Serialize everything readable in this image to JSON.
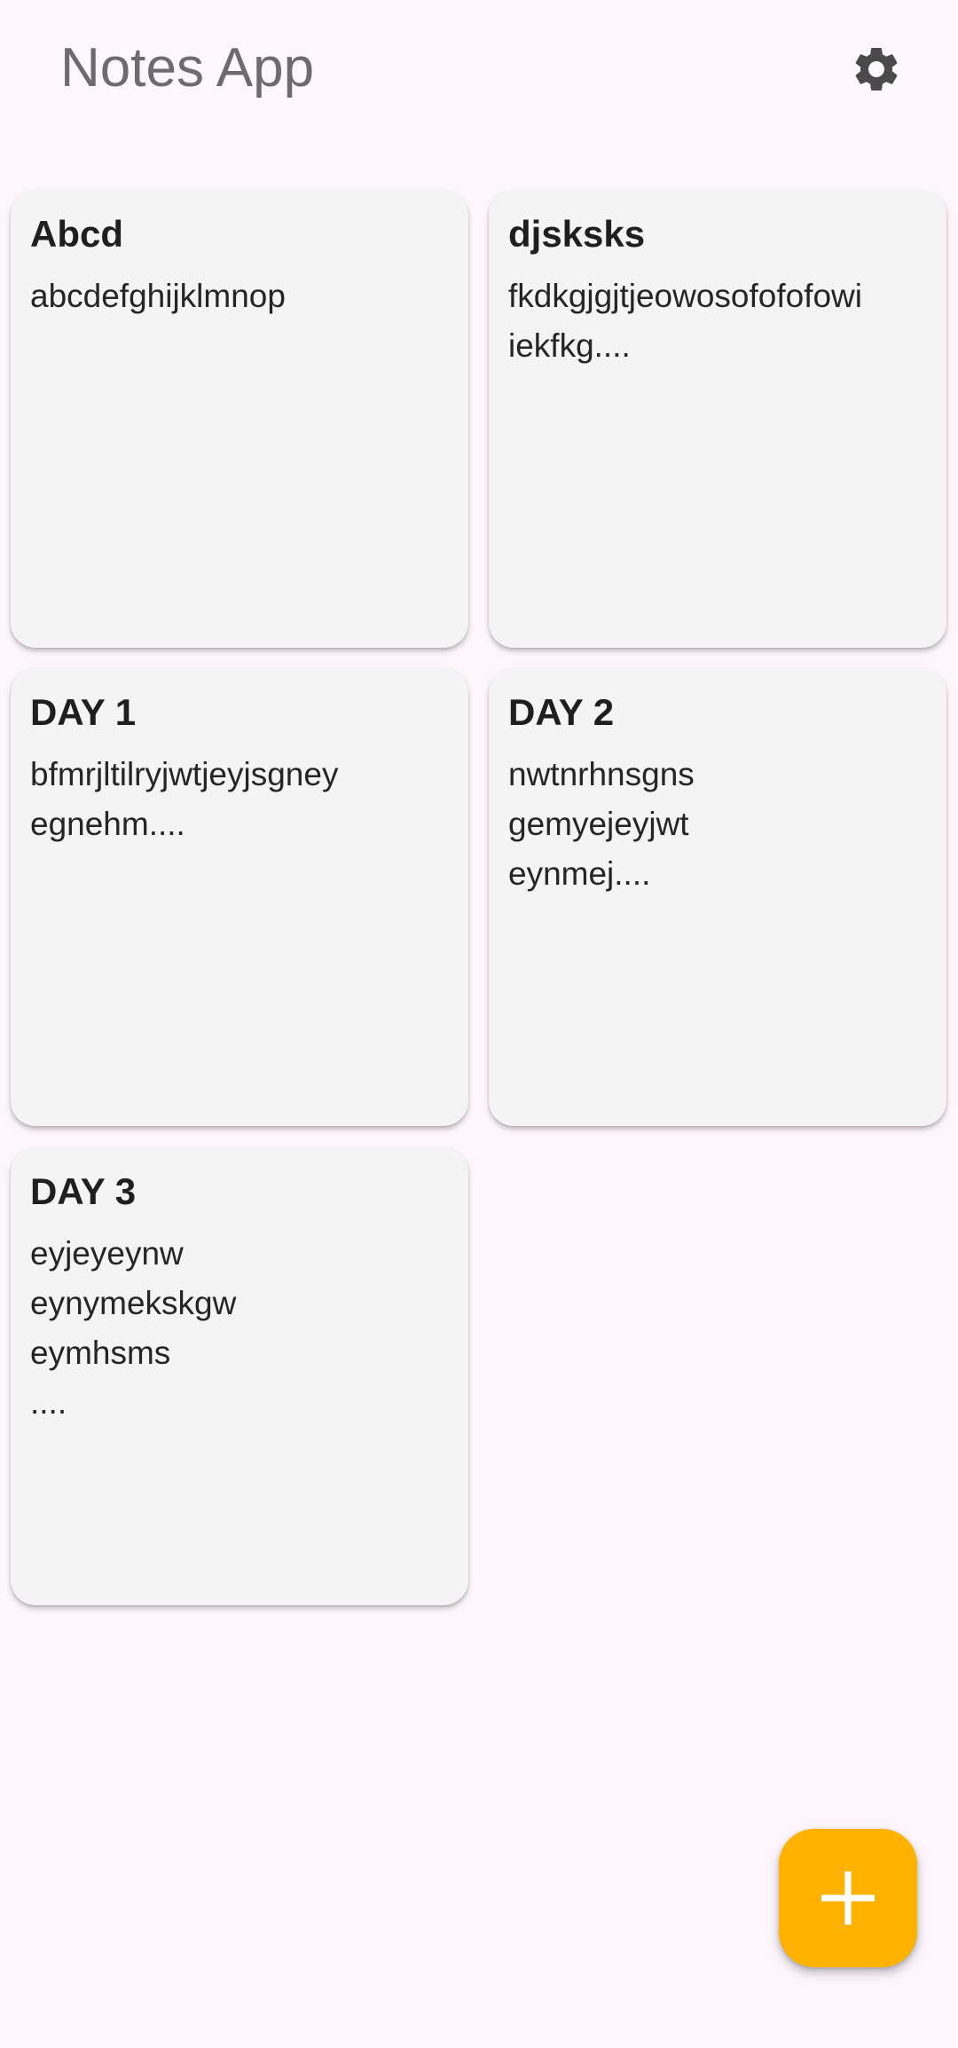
{
  "app_bar": {
    "title": "Notes App",
    "settings_icon": "gear-icon"
  },
  "notes": [
    {
      "title": "Abcd",
      "body": "abcdefghijklmnop"
    },
    {
      "title": "djsksks",
      "body": "fkdkgjgjtjeowosofofofowi\niekfkg...."
    },
    {
      "title": "DAY 1",
      "body": "bfmrjltilryjwtjeyjsgney\negnehm...."
    },
    {
      "title": "DAY 2",
      "body": "nwtnrhnsgns\ngemyejeyjwt\neynmej...."
    },
    {
      "title": "DAY 3",
      "body": "eyjeyeynw\neynymekskgw\neymhsms\n...."
    }
  ],
  "fab": {
    "icon": "plus-icon",
    "color": "#ffb300"
  },
  "colors": {
    "background": "#fdf6fd",
    "card": "#f4f4f4",
    "title_text": "#6e6a70"
  }
}
